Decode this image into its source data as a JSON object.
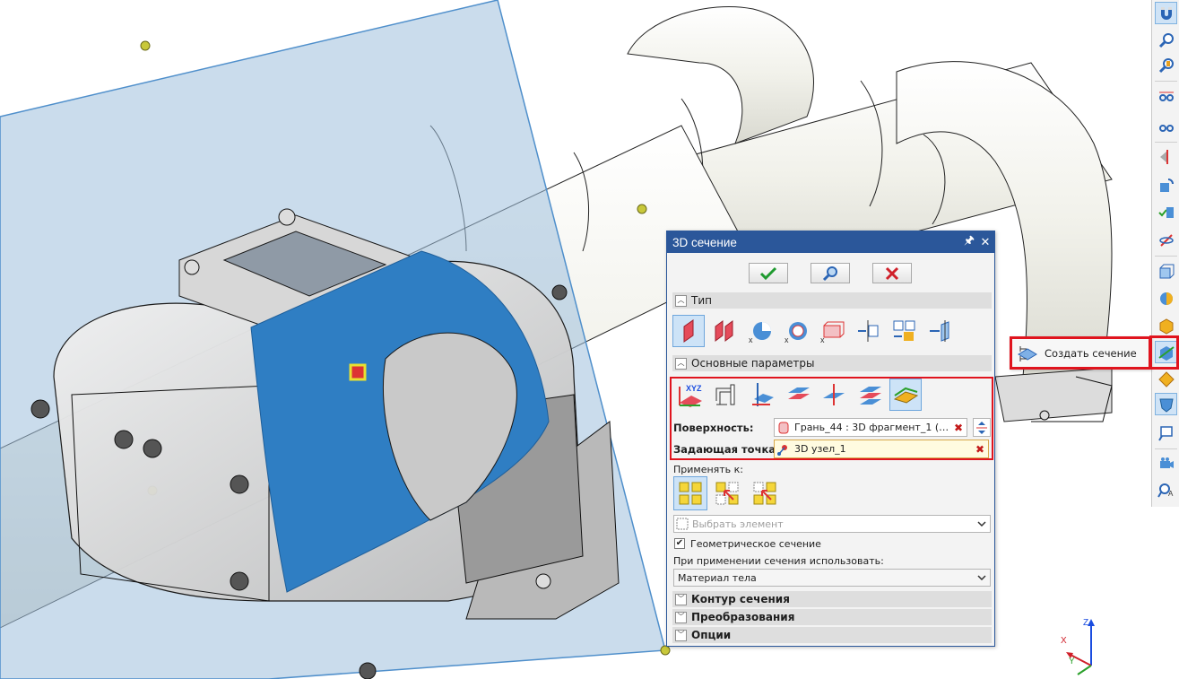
{
  "dialog": {
    "title": "3D сечение",
    "pin_glyph": "🖈",
    "close_glyph": "✕",
    "sections": {
      "type": "Тип",
      "main_params": "Основные параметры",
      "section_contour": "Контур сечения",
      "transformations": "Преобразования",
      "options": "Опции"
    },
    "surface_label": "Поверхность:",
    "surface_value": "Грань_44 : 3D фрагмент_1 (АОД...",
    "point_label": "Задающая точка:",
    "point_value": "3D узел_1",
    "apply_to_label": "Применять к:",
    "select_element_placeholder": "Выбрать элемент",
    "geometric_section_label": "Геометрическое сечение",
    "geometric_section_checked": true,
    "use_when_applying_label": "При применении сечения использовать:",
    "material_value": "Материал тела"
  },
  "flyout": {
    "label": "Создать сечение"
  },
  "triad": {
    "z": "Z",
    "x": "X",
    "y": "Y"
  },
  "colors": {
    "accent_blue": "#2b579a",
    "highlight_red": "#e0141e",
    "section_plane": "#9fbfdc",
    "cut_face": "#2f7ec3",
    "pipe": "#f3f3ec"
  },
  "icons": {
    "type_buttons": [
      "plane-section-icon",
      "two-planes-section-icon",
      "sector-section-icon",
      "cylinder-sector-icon",
      "box-section-icon",
      "axis-section-icon",
      "box-axis-section-icon",
      "arrow-plane-section-icon"
    ],
    "param_buttons": [
      "xyz-plane-icon",
      "offset-plane-icon",
      "axis-plane-icon",
      "parallel-plane-icon",
      "perpendicular-plane-icon",
      "two-planes-icon",
      "surface-plane-icon"
    ],
    "apply_buttons": [
      "all-elements-icon",
      "selected-elements-icon",
      "exclude-elements-icon"
    ]
  }
}
